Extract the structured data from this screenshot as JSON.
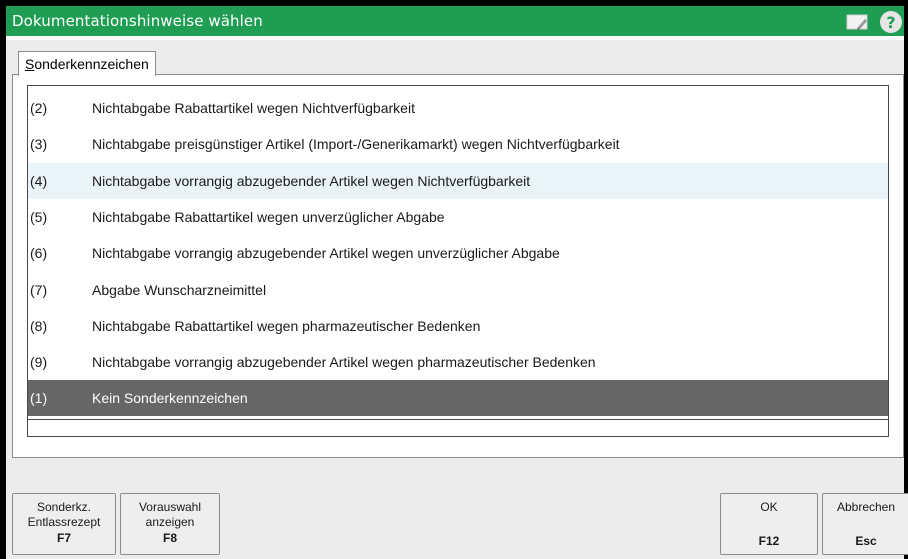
{
  "window": {
    "title": "Dokumentationshinweise wählen",
    "accent": "#1f9d52"
  },
  "tab": {
    "accel": "S",
    "rest": "onderkennzeichen"
  },
  "items": [
    {
      "code": "(2)",
      "label": "Nichtabgabe Rabattartikel wegen Nichtverfügbarkeit"
    },
    {
      "code": "(3)",
      "label": "Nichtabgabe preisgünstiger Artikel (Import-/Generikamarkt) wegen Nichtverfügbarkeit"
    },
    {
      "code": "(4)",
      "label": "Nichtabgabe vorrangig abzugebender Artikel wegen Nichtverfügbarkeit"
    },
    {
      "code": "(5)",
      "label": "Nichtabgabe Rabattartikel wegen unverzüglicher Abgabe"
    },
    {
      "code": "(6)",
      "label": "Nichtabgabe vorrangig abzugebender Artikel wegen unverzüglicher Abgabe"
    },
    {
      "code": "(7)",
      "label": "Abgabe Wunscharzneimittel"
    },
    {
      "code": "(8)",
      "label": "Nichtabgabe Rabattartikel wegen pharmazeutischer Bedenken"
    },
    {
      "code": "(9)",
      "label": "Nichtabgabe vorrangig abzugebender Artikel wegen pharmazeutischer Bedenken"
    },
    {
      "code": "(1)",
      "label": "Kein Sonderkennzeichen"
    }
  ],
  "hover_item": "(4)",
  "selected_item": "(1)",
  "buttons": {
    "f7": {
      "line1": "Sonderkz.",
      "line2": "Entlassrezept",
      "key": "F7"
    },
    "f8": {
      "line1": "Vorauswahl",
      "line2": "anzeigen",
      "key": "F8"
    },
    "ok": {
      "line1": "OK",
      "key": "F12"
    },
    "cancel": {
      "line1": "Abbrechen",
      "key": "Esc"
    }
  },
  "icons": {
    "note": "note-edit-icon",
    "help": "help-icon"
  }
}
